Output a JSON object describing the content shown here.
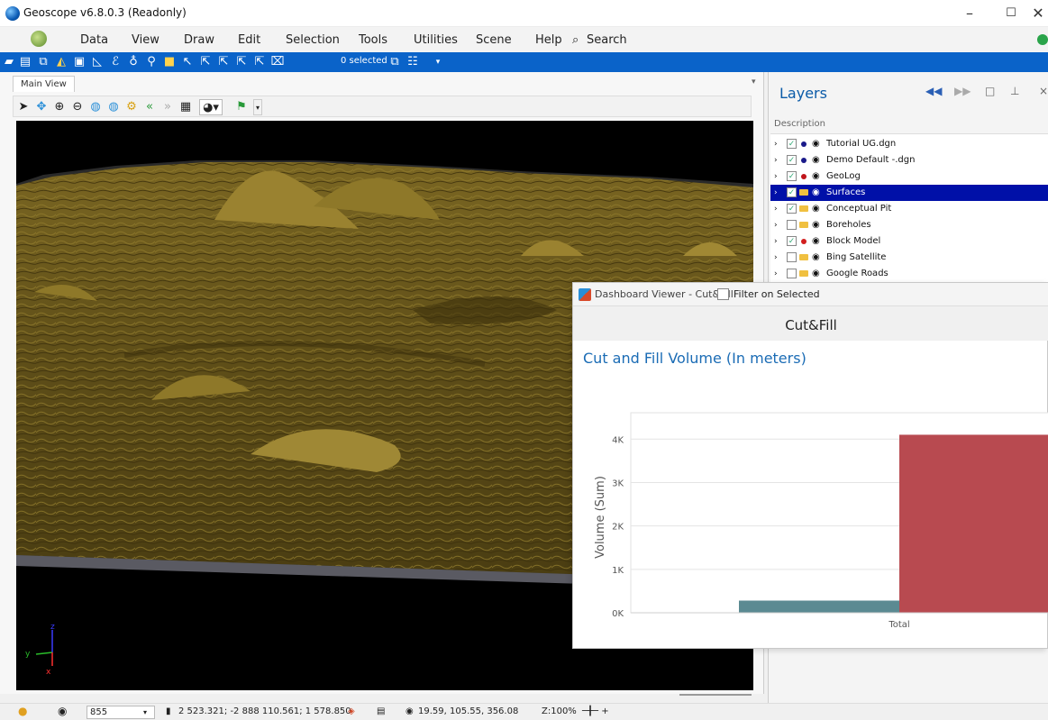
{
  "window": {
    "title": "Geoscope v6.8.0.3 (Readonly)",
    "controls": [
      "–",
      "☐",
      "✕"
    ]
  },
  "menu": {
    "items": [
      "Data",
      "View",
      "Draw",
      "Edit",
      "Selection",
      "Tools",
      "Utilities",
      "Scene",
      "Help"
    ],
    "search_label": "Search"
  },
  "toolbar": {
    "selected_text": "0 selected"
  },
  "main_view": {
    "tab_label": "Main View",
    "axis_labels": {
      "z": "z",
      "y": "y",
      "x": "x"
    }
  },
  "layers": {
    "title": "Layers",
    "description_header": "Description",
    "items": [
      {
        "label": "Tutorial UG.dgn",
        "checked": true,
        "selected": false,
        "dot": "#1a1a8a"
      },
      {
        "label": "Demo  Default -.dgn",
        "checked": true,
        "selected": false,
        "dot": "#1a1a8a"
      },
      {
        "label": "GeoLog",
        "checked": true,
        "selected": false,
        "dot": "#c0151b"
      },
      {
        "label": "Surfaces",
        "checked": true,
        "selected": true,
        "dot": ""
      },
      {
        "label": "Conceptual Pit",
        "checked": true,
        "selected": false,
        "dot": ""
      },
      {
        "label": "Boreholes",
        "checked": false,
        "selected": false,
        "dot": ""
      },
      {
        "label": "Block Model",
        "checked": true,
        "selected": false,
        "dot": "#d21f1f"
      },
      {
        "label": "Bing Satellite",
        "checked": false,
        "selected": false,
        "dot": ""
      },
      {
        "label": "Google Roads",
        "checked": false,
        "selected": false,
        "dot": ""
      }
    ]
  },
  "dashboard": {
    "window_title": "Dashboard Viewer - Cut&Fill",
    "filter_label": "Filter on Selected",
    "sub_title": "Cut&Fill",
    "chart_title": "Cut and Fill Volume (In meters)"
  },
  "chart_data": {
    "type": "bar",
    "categories": [
      "Total"
    ],
    "series": [
      {
        "name": "",
        "values": [
          280
        ],
        "color": "#5b8a92"
      },
      {
        "name": "",
        "values": [
          4100
        ],
        "color": "#b84a50"
      }
    ],
    "ylabel": "Volume (Sum)",
    "xlabel": "",
    "ylim": [
      0,
      4400
    ],
    "yticks": [
      0,
      1000,
      2000,
      3000,
      4000
    ],
    "ytick_labels": [
      "0K",
      "1K",
      "2K",
      "3K",
      "4K"
    ],
    "grid": true
  },
  "status": {
    "zoom_value": "855",
    "coordinates": "2 523.321; -2 888 110.561; 1 578.850",
    "view_params": "19.59, 105.55, 356.08",
    "zoom_pct": "Z:100%"
  },
  "colors": {
    "accent": "#0a63c9",
    "terrain": "#6b5a1f",
    "selected_row": "#0010a8"
  }
}
